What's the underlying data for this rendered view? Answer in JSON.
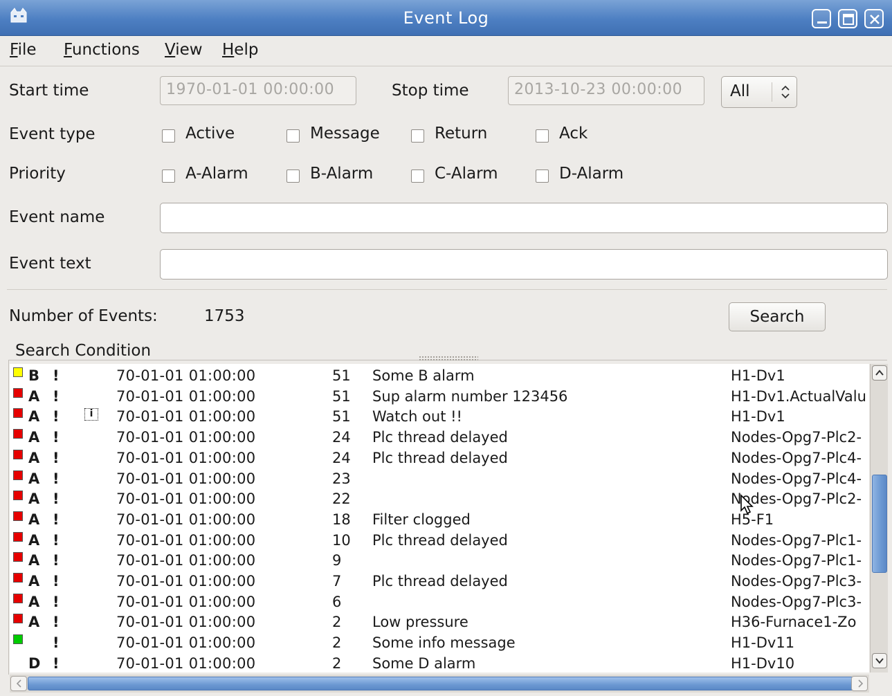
{
  "window": {
    "title": "Event Log"
  },
  "menu": [
    {
      "label": "File",
      "mnemonic": "F",
      "rest": "ile"
    },
    {
      "label": "Functions",
      "mnemonic": "F",
      "rest": "unctions"
    },
    {
      "label": "View",
      "mnemonic": "V",
      "rest": "iew"
    },
    {
      "label": "Help",
      "mnemonic": "H",
      "rest": "elp"
    }
  ],
  "filters": {
    "start_time_label": "Start time",
    "start_time_value": "1970-01-01 00:00:00",
    "stop_time_label": "Stop time",
    "stop_time_value": "2013-10-23 00:00:00",
    "range_select": "All",
    "event_type_label": "Event type",
    "event_types": [
      "Active",
      "Message",
      "Return",
      "Ack"
    ],
    "priority_label": "Priority",
    "priorities": [
      "A-Alarm",
      "B-Alarm",
      "C-Alarm",
      "D-Alarm"
    ],
    "event_name_label": "Event name",
    "event_name_value": "",
    "event_text_label": "Event text",
    "event_text_value": ""
  },
  "summary": {
    "count_label": "Number of Events:",
    "count_value": "1753",
    "search_button": "Search"
  },
  "search_condition_title": "Search Condition",
  "colors": {
    "A": "#e60000",
    "B": "#ffff00",
    "info": "#00cc00",
    "D": "transparent"
  },
  "events": [
    {
      "prio_color": "B",
      "prio": "B",
      "flag": "!",
      "info": false,
      "time": "70-01-01 01:00:00",
      "num": "51",
      "text": "Some B alarm",
      "name": "H1-Dv1"
    },
    {
      "prio_color": "A",
      "prio": "A",
      "flag": "!",
      "info": false,
      "time": "70-01-01 01:00:00",
      "num": "51",
      "text": "Sup alarm number 123456",
      "name": "H1-Dv1.ActualValu"
    },
    {
      "prio_color": "A",
      "prio": "A",
      "flag": "!",
      "info": true,
      "time": "70-01-01 01:00:00",
      "num": "51",
      "text": "Watch out !!",
      "name": "H1-Dv1"
    },
    {
      "prio_color": "A",
      "prio": "A",
      "flag": "!",
      "info": false,
      "time": "70-01-01 01:00:00",
      "num": "24",
      "text": "Plc thread delayed",
      "name": "Nodes-Opg7-Plc2-"
    },
    {
      "prio_color": "A",
      "prio": "A",
      "flag": "!",
      "info": false,
      "time": "70-01-01 01:00:00",
      "num": "24",
      "text": "Plc thread delayed",
      "name": "Nodes-Opg7-Plc4-"
    },
    {
      "prio_color": "A",
      "prio": "A",
      "flag": "!",
      "info": false,
      "time": "70-01-01 01:00:00",
      "num": "23",
      "text": "",
      "name": "Nodes-Opg7-Plc4-"
    },
    {
      "prio_color": "A",
      "prio": "A",
      "flag": "!",
      "info": false,
      "time": "70-01-01 01:00:00",
      "num": "22",
      "text": "",
      "name": "Nodes-Opg7-Plc2-"
    },
    {
      "prio_color": "A",
      "prio": "A",
      "flag": "!",
      "info": false,
      "time": "70-01-01 01:00:00",
      "num": "18",
      "text": "Filter clogged",
      "name": "H5-F1"
    },
    {
      "prio_color": "A",
      "prio": "A",
      "flag": "!",
      "info": false,
      "time": "70-01-01 01:00:00",
      "num": "10",
      "text": "Plc thread delayed",
      "name": "Nodes-Opg7-Plc1-"
    },
    {
      "prio_color": "A",
      "prio": "A",
      "flag": "!",
      "info": false,
      "time": "70-01-01 01:00:00",
      "num": "9",
      "text": "",
      "name": "Nodes-Opg7-Plc1-"
    },
    {
      "prio_color": "A",
      "prio": "A",
      "flag": "!",
      "info": false,
      "time": "70-01-01 01:00:00",
      "num": "7",
      "text": "Plc thread delayed",
      "name": "Nodes-Opg7-Plc3-"
    },
    {
      "prio_color": "A",
      "prio": "A",
      "flag": "!",
      "info": false,
      "time": "70-01-01 01:00:00",
      "num": "6",
      "text": "",
      "name": "Nodes-Opg7-Plc3-"
    },
    {
      "prio_color": "A",
      "prio": "A",
      "flag": "!",
      "info": false,
      "time": "70-01-01 01:00:00",
      "num": "2",
      "text": "Low pressure",
      "name": "H36-Furnace1-Zo"
    },
    {
      "prio_color": "info",
      "prio": "",
      "flag": "!",
      "info": false,
      "time": "70-01-01 01:00:00",
      "num": "2",
      "text": "Some info message",
      "name": "H1-Dv11"
    },
    {
      "prio_color": "D",
      "prio": "D",
      "flag": "!",
      "info": false,
      "time": "70-01-01 01:00:00",
      "num": "2",
      "text": "Some D alarm",
      "name": "H1-Dv10"
    }
  ]
}
